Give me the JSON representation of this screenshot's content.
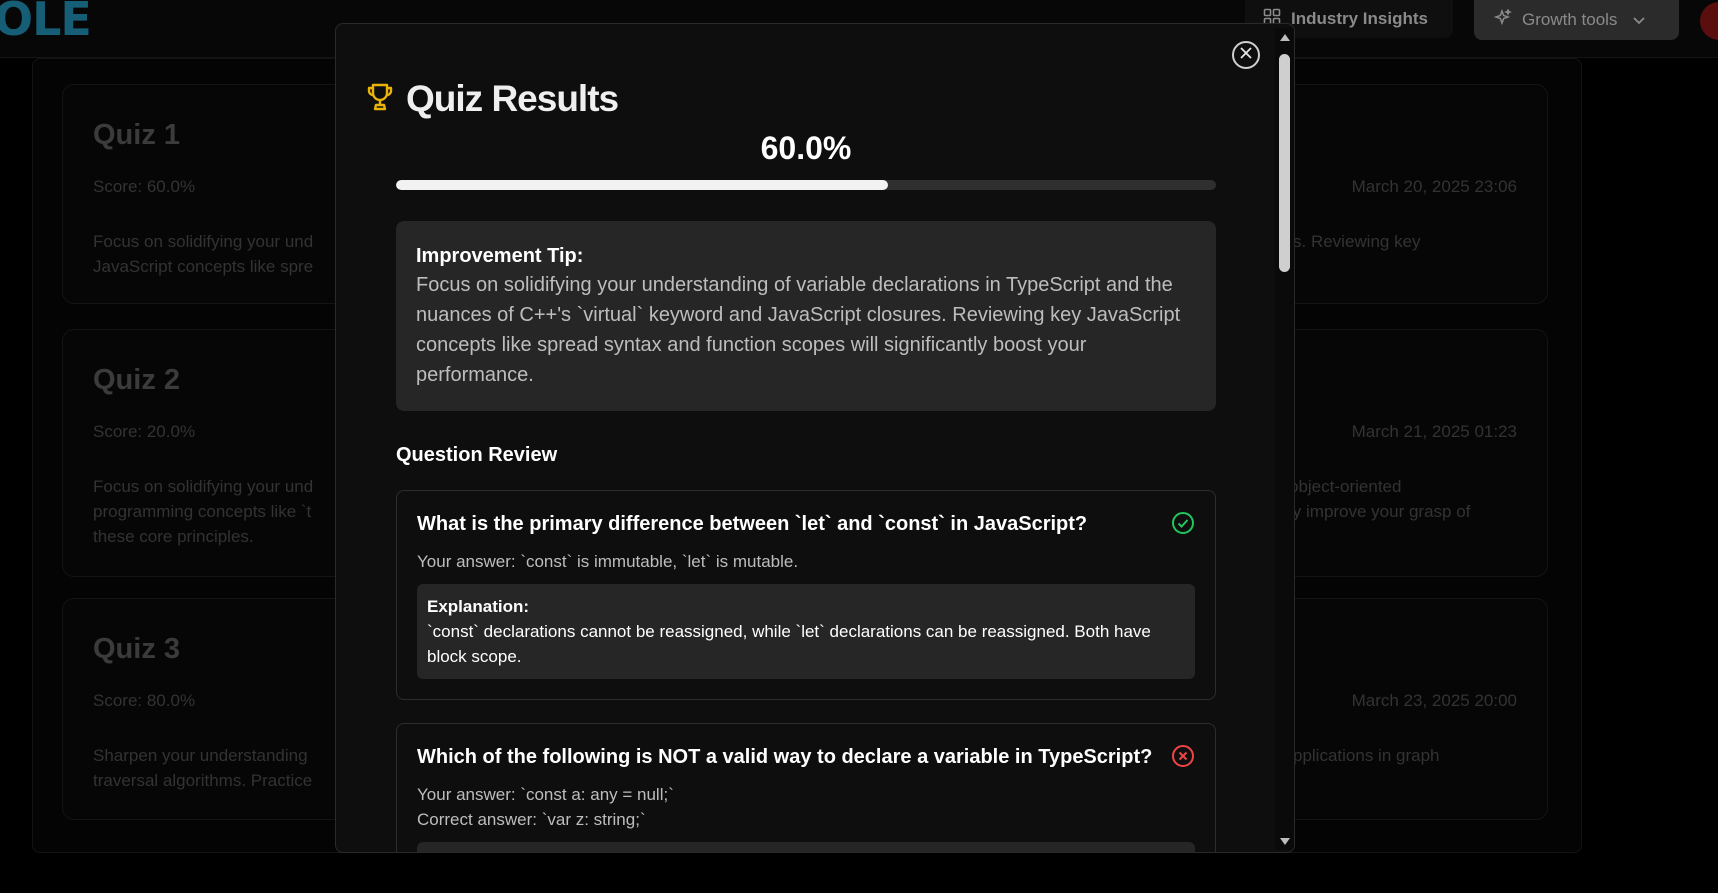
{
  "header": {
    "logo_text": "OLE",
    "industry_insights": "Industry Insights",
    "growth_tools": "Growth tools"
  },
  "quizzes": [
    {
      "title": "Quiz 1",
      "score": "Score: 60.0%",
      "date": "March 20, 2025 23:06",
      "tip_left": "Focus on solidifying your und",
      "tip_left2": "JavaScript concepts like spre",
      "tip_right": "s. Reviewing key",
      "tip_right2": ""
    },
    {
      "title": "Quiz 2",
      "score": "Score: 20.0%",
      "date": "March 21, 2025 01:23",
      "tip_left": "Focus on solidifying your und",
      "tip_left2": "programming concepts like `t",
      "tip_left3": "these core principles.",
      "tip_right": "object-oriented",
      "tip_right2": "ly improve your grasp of"
    },
    {
      "title": "Quiz 3",
      "score": "Score: 80.0%",
      "date": "March 23, 2025 20:00",
      "tip_left": "Sharpen your understanding",
      "tip_left2": "traversal algorithms. Practice",
      "tip_right": "pplications in graph",
      "tip_right2": ""
    }
  ],
  "modal": {
    "title": "Quiz Results",
    "score_text": "60.0%",
    "score_fraction": 0.6,
    "tip_title": "Improvement Tip:",
    "tip_text": "Focus on solidifying your understanding of variable declarations in TypeScript and the nuances of C++'s `virtual` keyword and JavaScript closures. Reviewing key JavaScript concepts like spread syntax and function scopes will significantly boost your performance.",
    "review_heading": "Question Review",
    "questions": [
      {
        "question": "What is the primary difference between `let` and `const` in JavaScript?",
        "status": "correct",
        "your_answer": "Your answer: `const` is immutable, `let` is mutable.",
        "explanation_title": "Explanation:",
        "explanation": "`const` declarations cannot be reassigned, while `let` declarations can be reassigned. Both have block scope."
      },
      {
        "question": "Which of the following is NOT a valid way to declare a variable in TypeScript?",
        "status": "incorrect",
        "your_answer": "Your answer: `const a: any = null;`",
        "correct_answer": "Correct answer: `var z: string;`"
      }
    ]
  },
  "colors": {
    "correct": "#22c55e",
    "incorrect": "#ef4444",
    "trophy": "#eab308",
    "logo": "#155e75"
  }
}
